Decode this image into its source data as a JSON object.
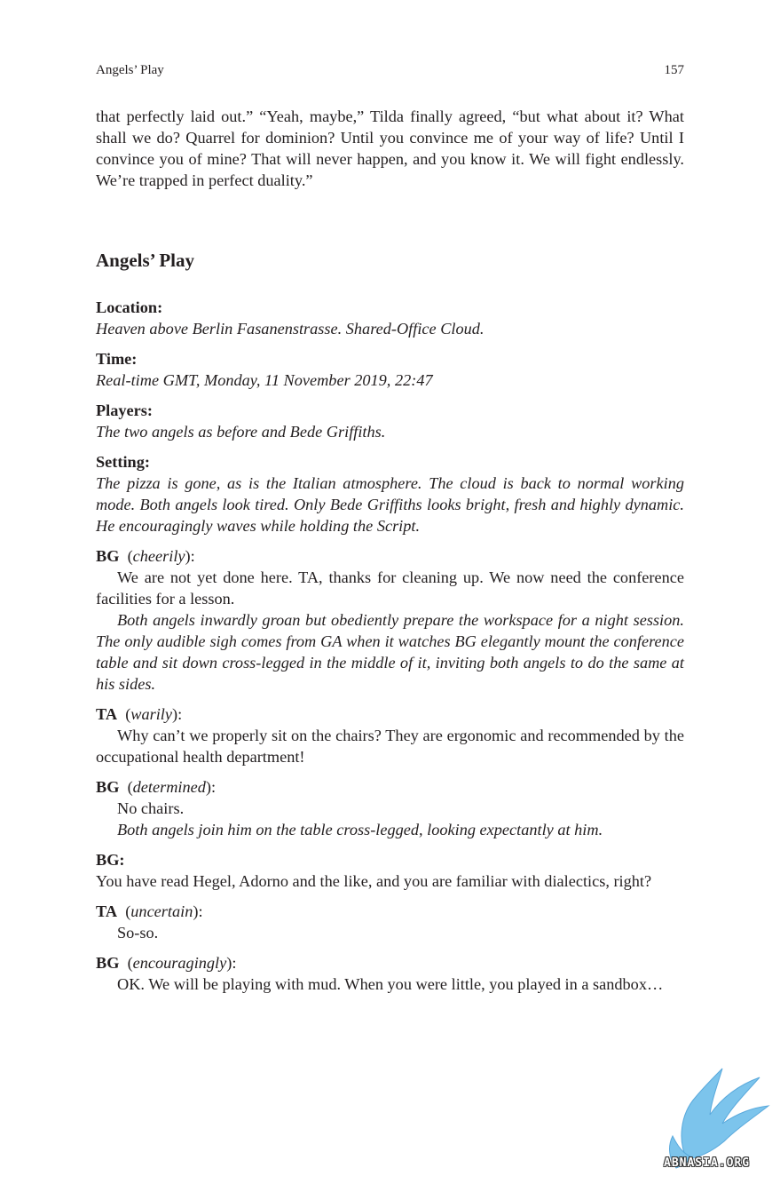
{
  "header": {
    "title": "Angels’ Play",
    "page_number": "157"
  },
  "intro_paragraph": "that perfectly laid out.” “Yeah, maybe,” Tilda finally agreed, “but what about it? What shall we do? Quarrel for dominion? Until you convince me of your way of life? Until I convince you of mine? That will never happen, and you know it. We will fight endlessly. We’re trapped in perfect duality.”",
  "section_title": "Angels’ Play",
  "location": {
    "label": "Location:",
    "text": "Heaven above Berlin Fasanenstrasse. Shared-Office Cloud."
  },
  "time": {
    "label": "Time:",
    "text": "Real-time GMT, Monday, 11 November 2019, 22:47"
  },
  "players": {
    "label": "Players:",
    "text": "The two angels as before and Bede Griffiths."
  },
  "setting": {
    "label": "Setting:",
    "text": "The pizza is gone, as is the Italian atmosphere. The cloud is back to normal working mode. Both angels look tired. Only Bede Griffiths looks bright, fresh and highly dynamic. He encouragingly waves while holding the Script."
  },
  "dialogue": [
    {
      "speaker": "BG",
      "direction": "cheerily",
      "speech": "We are not yet done here. TA, thanks for cleaning up. We now need the conference facilities for a lesson.",
      "stage": "Both angels inwardly groan but obediently prepare the workspace for a night session. The only audible sigh comes from GA when it watches BG elegantly mount the conference table and sit down cross-legged in the middle of it, inviting both angels to do the same at his sides."
    },
    {
      "speaker": "TA",
      "direction": "warily",
      "speech": "Why can’t we properly sit on the chairs? They are ergonomic and recommended by the occupational health department!"
    },
    {
      "speaker": "BG",
      "direction": "determined",
      "speech": "No chairs.",
      "stage": "Both angels join him on the table cross-legged, looking expectantly at him."
    },
    {
      "speaker": "BG:",
      "speech": "You have read Hegel, Adorno and the like, and you are familiar with dialectics, right?"
    },
    {
      "speaker": "TA",
      "direction": "uncertain",
      "speech": "So-so."
    },
    {
      "speaker": "BG",
      "direction": "encouragingly",
      "speech": "OK. We will be playing with mud. When you were little, you played in a sandbox…"
    }
  ],
  "watermark": {
    "text": "ABNASIA.ORG",
    "color": "#6fb8e6"
  }
}
